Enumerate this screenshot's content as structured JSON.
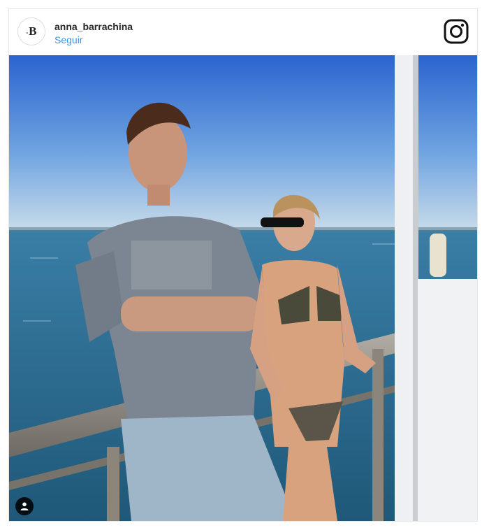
{
  "post": {
    "username": "anna_barrachina",
    "follow_label": "Seguir",
    "avatar_initial": "B",
    "avatar_dot": "."
  },
  "icons": {
    "platform_logo": "instagram-icon",
    "user_tag": "person-tag-icon"
  },
  "colors": {
    "follow_link": "#3897f0",
    "username": "#262626",
    "sky_top": "#2f6fd6",
    "sea": "#2f6b8f"
  }
}
